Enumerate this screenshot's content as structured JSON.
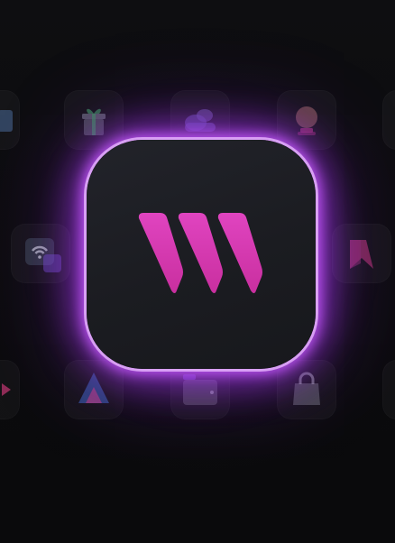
{
  "screen": {
    "description_tag": "app-icon-showcase"
  },
  "app_icon": {
    "name": "w-logo-icon",
    "accent_gradient": [
      "#e43fb8",
      "#c23ad9"
    ],
    "glow_color": "#b347ff",
    "tile_color": "#1c1d22"
  },
  "background_icons": [
    "book-icon",
    "gift-icon",
    "cloud-icon",
    "globe-icon",
    "partial-icon",
    "wifi-icon",
    "bookmark-icon",
    "play-icon",
    "triangle-icon",
    "wallet-icon",
    "shopping-bag-icon",
    "partial-icon"
  ],
  "colors": {
    "background": "#0b0b0d",
    "faint_icon_tile": "#141417"
  }
}
